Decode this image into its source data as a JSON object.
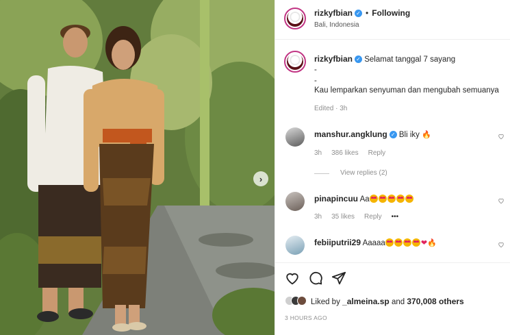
{
  "post": {
    "username": "rizkyfbian",
    "dot": "•",
    "follow_status": "Following",
    "location": "Bali, Indonesia",
    "more_icon": "more-horizontal-icon"
  },
  "caption": {
    "username": "rizkyfbian",
    "lines": [
      "Selamat tanggal 7 sayang",
      "-",
      "-",
      "Kau lemparkan senyuman dan mengubah semuanya"
    ],
    "meta": "Edited · 3h"
  },
  "comments": [
    {
      "username": "manshur.angklung",
      "verified": true,
      "text": "Bli iky",
      "time": "3h",
      "likes": "386 likes",
      "reply": "Reply",
      "view_replies": "View replies (2)"
    },
    {
      "username": "pinapincuu",
      "text": "Aa",
      "time": "3h",
      "likes": "35 likes",
      "reply": "Reply",
      "more": "•••"
    },
    {
      "username": "febiiputrii29",
      "text": "Aaaaa"
    }
  ],
  "actions": {
    "icons": [
      "heart-icon",
      "comment-icon",
      "share-icon"
    ],
    "liked_by_prefix": "Liked by",
    "liked_by_user": "_almeina.sp",
    "liked_by_and": "and",
    "liked_by_others": "370,008 others",
    "timestamp": "3 HOURS AGO"
  },
  "carousel": {
    "next_symbol": "›"
  },
  "colors": {
    "verified": "#3897f0",
    "text": "#262626",
    "muted": "#8e8e8e",
    "heart": "#e0245e"
  }
}
